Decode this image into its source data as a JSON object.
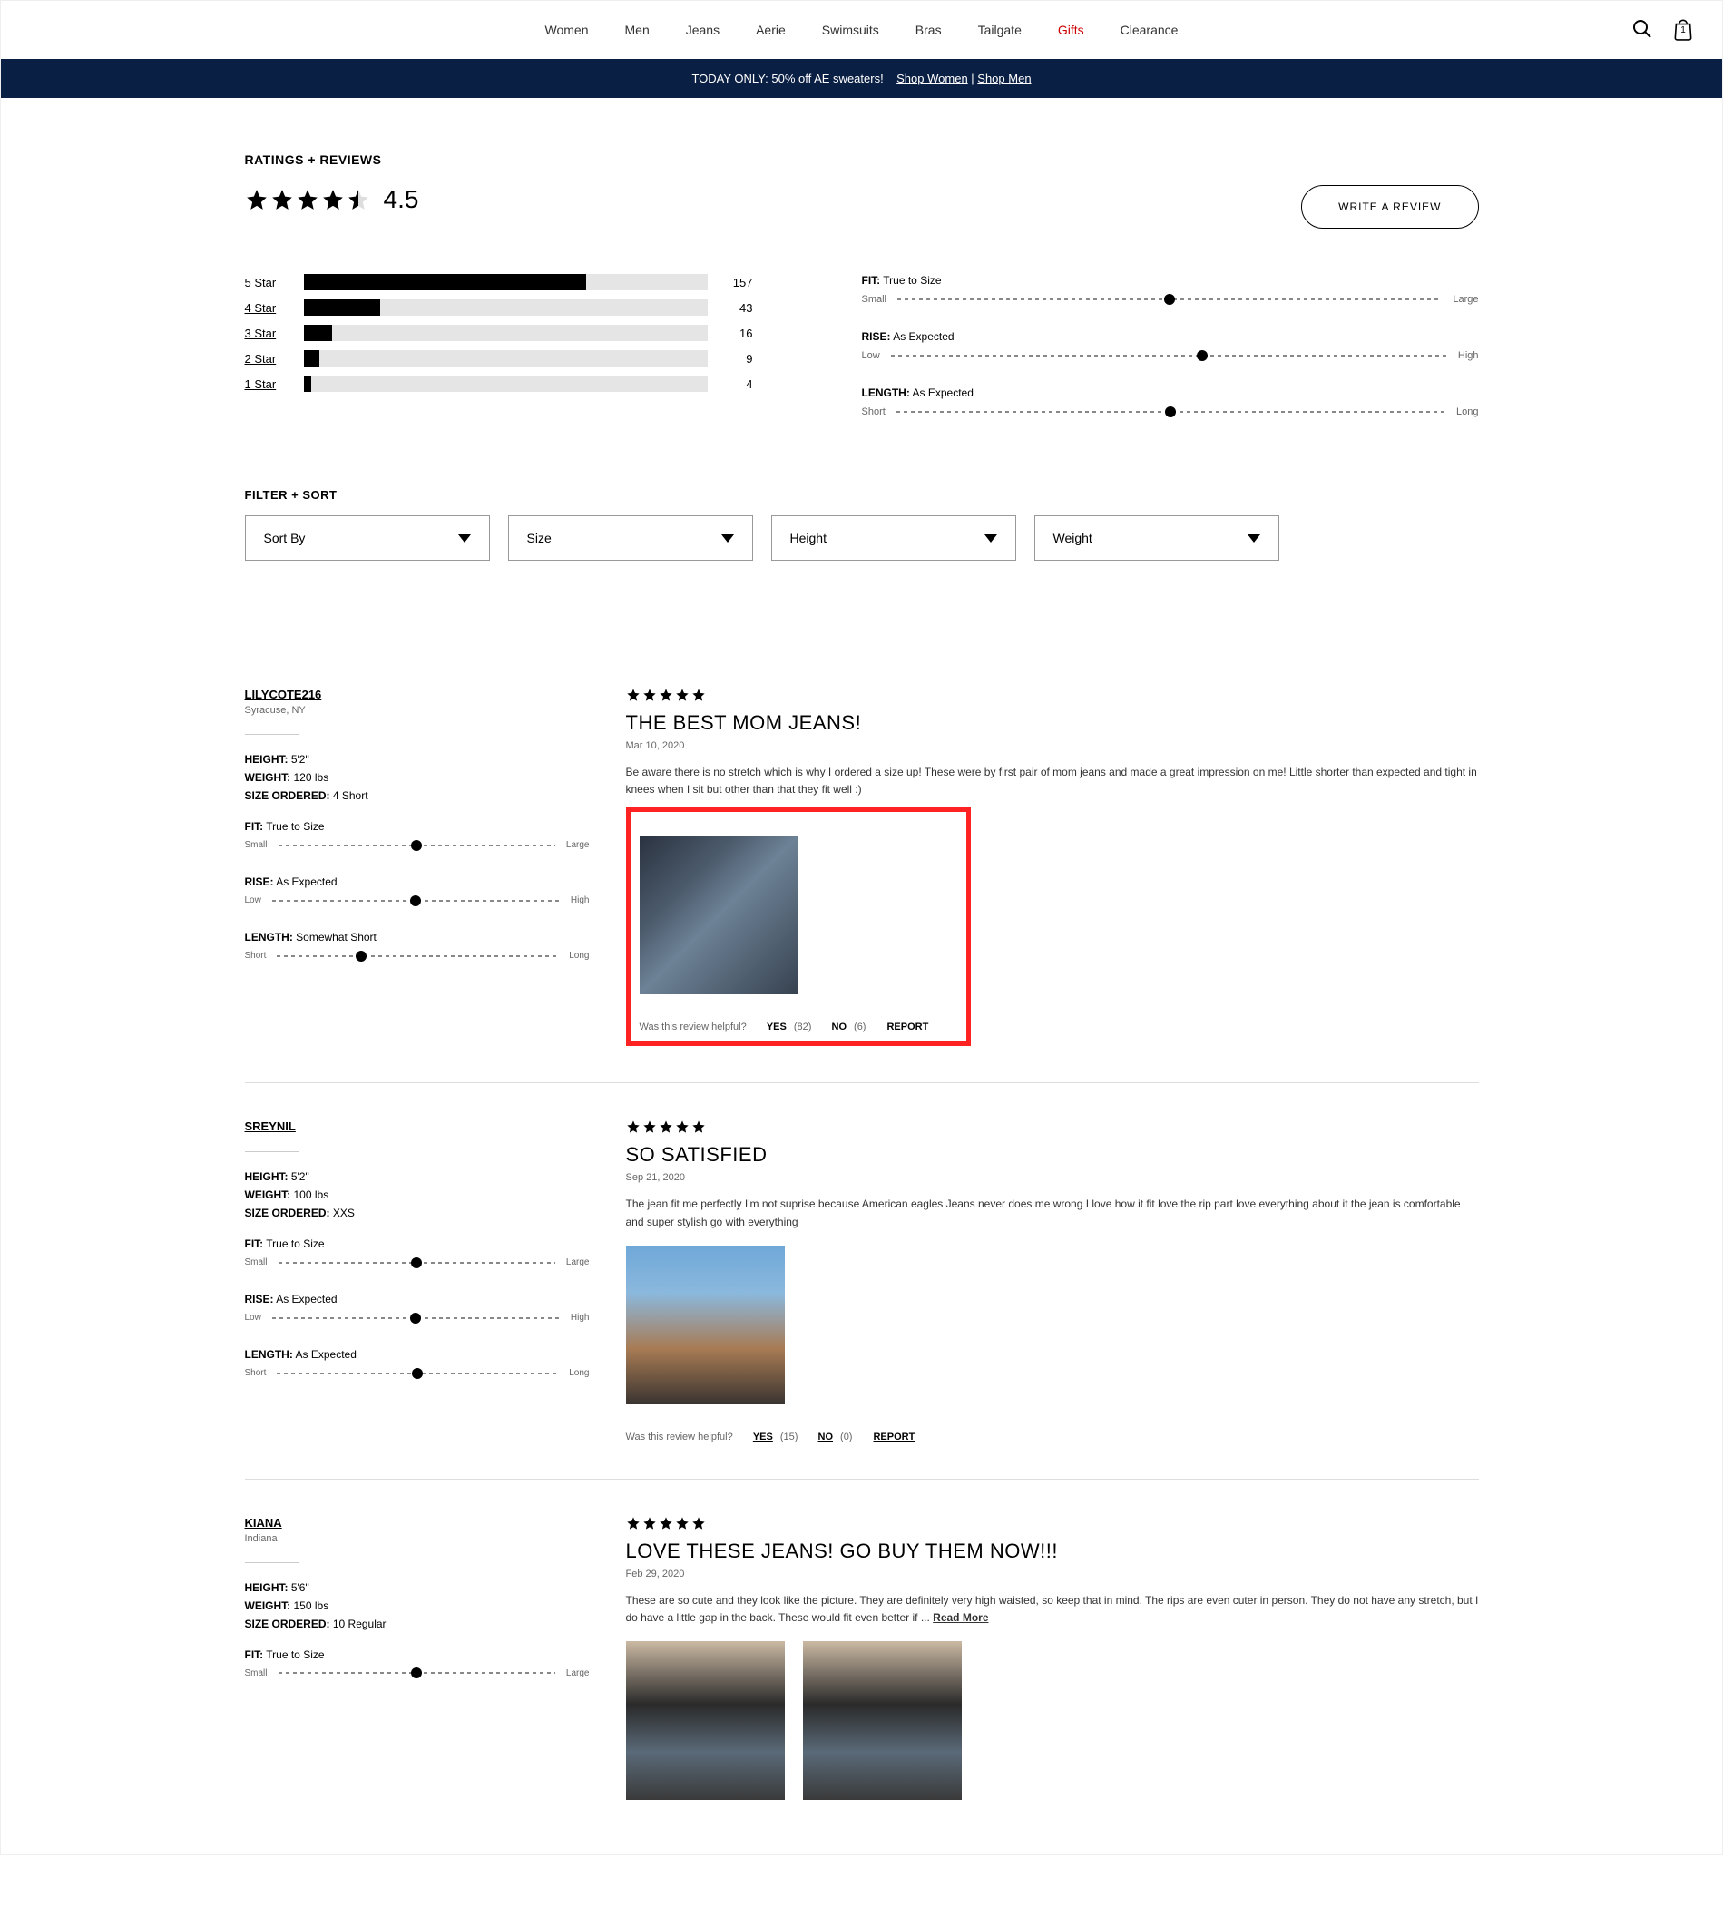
{
  "nav": {
    "items": [
      {
        "label": "Women",
        "active": false
      },
      {
        "label": "Men",
        "active": false
      },
      {
        "label": "Jeans",
        "active": false
      },
      {
        "label": "Aerie",
        "active": false
      },
      {
        "label": "Swimsuits",
        "active": false
      },
      {
        "label": "Bras",
        "active": false
      },
      {
        "label": "Tailgate",
        "active": false
      },
      {
        "label": "Gifts",
        "active": true
      },
      {
        "label": "Clearance",
        "active": false
      }
    ],
    "bag_count": "1"
  },
  "promo": {
    "text": "TODAY ONLY: 50% off AE sweaters!",
    "link1": "Shop Women",
    "sep": " | ",
    "link2": "Shop Men"
  },
  "ratings": {
    "title": "RATINGS + REVIEWS",
    "score": "4.5",
    "write_btn": "WRITE A REVIEW",
    "dist": [
      {
        "label": "5 Star",
        "count": "157",
        "pct": 70
      },
      {
        "label": "4 Star",
        "count": "43",
        "pct": 19
      },
      {
        "label": "3 Star",
        "count": "16",
        "pct": 7
      },
      {
        "label": "2 Star",
        "count": "9",
        "pct": 4
      },
      {
        "label": "1 Star",
        "count": "4",
        "pct": 2
      }
    ],
    "sliders": [
      {
        "name": "FIT:",
        "desc": "True to Size",
        "low": "Small",
        "high": "Large",
        "pos": 50
      },
      {
        "name": "RISE:",
        "desc": "As Expected",
        "low": "Low",
        "high": "High",
        "pos": 56
      },
      {
        "name": "LENGTH:",
        "desc": "As Expected",
        "low": "Short",
        "high": "Long",
        "pos": 50
      }
    ]
  },
  "filter": {
    "title": "FILTER + SORT",
    "options": [
      "Sort By",
      "Size",
      "Height",
      "Weight"
    ]
  },
  "reviews": [
    {
      "name": "LILYCOTE216",
      "loc": "Syracuse, NY",
      "attrs": [
        {
          "k": "HEIGHT:",
          "v": "5'2\""
        },
        {
          "k": "WEIGHT:",
          "v": "120 lbs"
        },
        {
          "k": "SIZE ORDERED:",
          "v": "4 Short"
        }
      ],
      "sliders": [
        {
          "name": "FIT:",
          "desc": "True to Size",
          "low": "Small",
          "high": "Large",
          "pos": 50
        },
        {
          "name": "RISE:",
          "desc": "As Expected",
          "low": "Low",
          "high": "High",
          "pos": 50
        },
        {
          "name": "LENGTH:",
          "desc": "Somewhat Short",
          "low": "Short",
          "high": "Long",
          "pos": 30
        }
      ],
      "stars": 5,
      "title": "THE BEST MOM JEANS!",
      "date": "Mar 10, 2020",
      "text": "Be aware there is no stretch which is why I ordered a size up! These were by first pair of mom jeans and made a great impression on me! Little shorter than expected and tight in knees when I sit but other than that they fit well :)",
      "images": [
        "img1"
      ],
      "helpful": {
        "prompt": "Was this review helpful?",
        "yes": "YES",
        "yes_n": "(82)",
        "no": "NO",
        "no_n": "(6)",
        "report": "REPORT"
      },
      "highlight": true
    },
    {
      "name": "SREYNIL",
      "loc": "",
      "attrs": [
        {
          "k": "HEIGHT:",
          "v": "5'2\""
        },
        {
          "k": "WEIGHT:",
          "v": "100 lbs"
        },
        {
          "k": "SIZE ORDERED:",
          "v": "XXS"
        }
      ],
      "sliders": [
        {
          "name": "FIT:",
          "desc": "True to Size",
          "low": "Small",
          "high": "Large",
          "pos": 50
        },
        {
          "name": "RISE:",
          "desc": "As Expected",
          "low": "Low",
          "high": "High",
          "pos": 50
        },
        {
          "name": "LENGTH:",
          "desc": "As Expected",
          "low": "Short",
          "high": "Long",
          "pos": 50
        }
      ],
      "stars": 5,
      "title": "SO SATISFIED",
      "date": "Sep 21, 2020",
      "text": "The jean fit me perfectly I'm not suprise because American eagles Jeans never does me wrong I love how it fit love the rip part love everything about it the jean is comfortable and super stylish go with everything",
      "images": [
        "img2"
      ],
      "helpful": {
        "prompt": "Was this review helpful?",
        "yes": "YES",
        "yes_n": "(15)",
        "no": "NO",
        "no_n": "(0)",
        "report": "REPORT"
      },
      "highlight": false
    },
    {
      "name": "KIANA",
      "loc": "Indiana",
      "attrs": [
        {
          "k": "HEIGHT:",
          "v": "5'6\""
        },
        {
          "k": "WEIGHT:",
          "v": "150 lbs"
        },
        {
          "k": "SIZE ORDERED:",
          "v": "10 Regular"
        }
      ],
      "sliders": [
        {
          "name": "FIT:",
          "desc": "True to Size",
          "low": "Small",
          "high": "Large",
          "pos": 50
        }
      ],
      "stars": 5,
      "title": "LOVE THESE JEANS! GO BUY THEM NOW!!!",
      "date": "Feb 29, 2020",
      "text": "These are so cute and they look like the picture. They are definitely very high waisted, so keep that in mind. The rips are even cuter in person. They do not have any stretch, but I do have a little gap in the back. These would fit even better if ... ",
      "read_more": "Read More",
      "images": [
        "img3",
        "img3"
      ],
      "highlight": false
    }
  ]
}
